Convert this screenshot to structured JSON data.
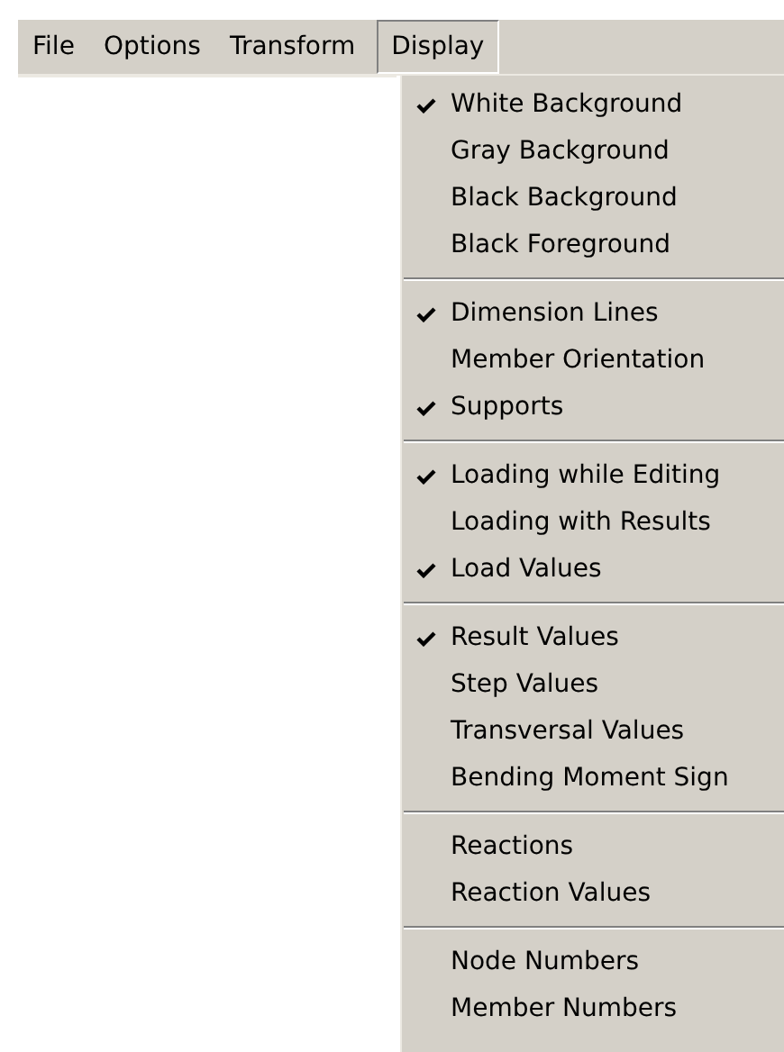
{
  "menu_bar": [
    {
      "label": "File",
      "selected": false
    },
    {
      "label": "Options",
      "selected": false
    },
    {
      "label": "Transform",
      "selected": false
    },
    {
      "label": "Display",
      "selected": true
    }
  ],
  "display_menu": {
    "groups": [
      [
        {
          "label": "White Background",
          "checked": true
        },
        {
          "label": "Gray Background",
          "checked": false
        },
        {
          "label": "Black Background",
          "checked": false
        },
        {
          "label": "Black Foreground",
          "checked": false
        }
      ],
      [
        {
          "label": "Dimension Lines",
          "checked": true
        },
        {
          "label": "Member Orientation",
          "checked": false
        },
        {
          "label": "Supports",
          "checked": true
        }
      ],
      [
        {
          "label": "Loading while Editing",
          "checked": true
        },
        {
          "label": "Loading with Results",
          "checked": false
        },
        {
          "label": "Load Values",
          "checked": true
        }
      ],
      [
        {
          "label": "Result Values",
          "checked": true
        },
        {
          "label": "Step Values",
          "checked": false
        },
        {
          "label": "Transversal Values",
          "checked": false
        },
        {
          "label": "Bending Moment Sign",
          "checked": false
        }
      ],
      [
        {
          "label": "Reactions",
          "checked": false
        },
        {
          "label": "Reaction Values",
          "checked": false
        }
      ],
      [
        {
          "label": "Node Numbers",
          "checked": false
        },
        {
          "label": "Member Numbers",
          "checked": false
        }
      ]
    ]
  }
}
